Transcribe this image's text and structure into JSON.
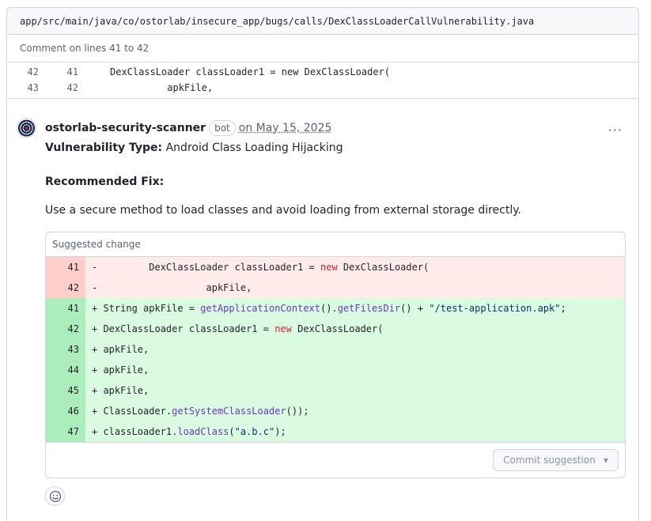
{
  "file": {
    "path": "app/src/main/java/co/ostorlab/insecure_app/bugs/calls/DexClassLoaderCallVulnerability.java"
  },
  "comment_on": "Comment on lines 41 to 42",
  "context_lines": [
    {
      "old": "42",
      "new": "41",
      "code": "DexClassLoader classLoader1 = new DexClassLoader("
    },
    {
      "old": "43",
      "new": "42",
      "code": "          apkFile,"
    }
  ],
  "comment": {
    "author": "ostorlab-security-scanner",
    "badge": "bot",
    "date": "on May 15, 2025",
    "more_label": "···",
    "vuln_label": "Vulnerability Type:",
    "vuln_value": " Android Class Loading Hijacking",
    "fix_heading": "Recommended Fix:",
    "fix_text": "Use a secure method to load classes and avoid loading from external storage directly."
  },
  "suggestion": {
    "title": "Suggested change",
    "commit_label": "Commit suggestion",
    "lines": [
      {
        "num": "41",
        "type": "del",
        "prefix": "-         ",
        "parts": [
          [
            "",
            "DexClassLoader classLoader1 = "
          ],
          [
            "kw",
            "new"
          ],
          [
            "",
            " DexClassLoader("
          ]
        ]
      },
      {
        "num": "42",
        "type": "del",
        "prefix": "-                   ",
        "parts": [
          [
            "",
            "apkFile,"
          ]
        ]
      },
      {
        "num": "41",
        "type": "add",
        "prefix": "+ ",
        "parts": [
          [
            "",
            "String apkFile = "
          ],
          [
            "fn",
            "getApplicationContext"
          ],
          [
            "",
            "()."
          ],
          [
            "fn",
            "getFilesDir"
          ],
          [
            "",
            "() + "
          ],
          [
            "str",
            "\"/test-application.apk\""
          ],
          [
            "",
            ";"
          ]
        ]
      },
      {
        "num": "42",
        "type": "add",
        "prefix": "+ ",
        "parts": [
          [
            "",
            "DexClassLoader classLoader1 = "
          ],
          [
            "kw",
            "new"
          ],
          [
            "",
            " DexClassLoader("
          ]
        ]
      },
      {
        "num": "43",
        "type": "add",
        "prefix": "+ ",
        "parts": [
          [
            "",
            "apkFile,"
          ]
        ]
      },
      {
        "num": "44",
        "type": "add",
        "prefix": "+ ",
        "parts": [
          [
            "",
            "apkFile,"
          ]
        ]
      },
      {
        "num": "45",
        "type": "add",
        "prefix": "+ ",
        "parts": [
          [
            "",
            "apkFile,"
          ]
        ]
      },
      {
        "num": "46",
        "type": "add",
        "prefix": "+ ",
        "parts": [
          [
            "",
            "ClassLoader."
          ],
          [
            "fn",
            "getSystemClassLoader"
          ],
          [
            "",
            "());"
          ]
        ]
      },
      {
        "num": "47",
        "type": "add",
        "prefix": "+ ",
        "parts": [
          [
            "",
            "classLoader1."
          ],
          [
            "fn",
            "loadClass"
          ],
          [
            "",
            "("
          ],
          [
            "str",
            "\"a.b.c\""
          ],
          [
            "",
            ");"
          ]
        ]
      }
    ]
  },
  "colors": {
    "del_num": "#ffcecb",
    "del_code": "#ffebe9",
    "add_num": "#aceebb",
    "add_code": "#dafbe1",
    "keyword": "#cf222e",
    "function": "#6639ba",
    "string": "#0a3069"
  },
  "icons": {
    "avatar": "scanner-avatar-icon",
    "reaction": "smiley-icon",
    "more": "kebab-horizontal-icon",
    "caret": "triangle-down-icon"
  }
}
